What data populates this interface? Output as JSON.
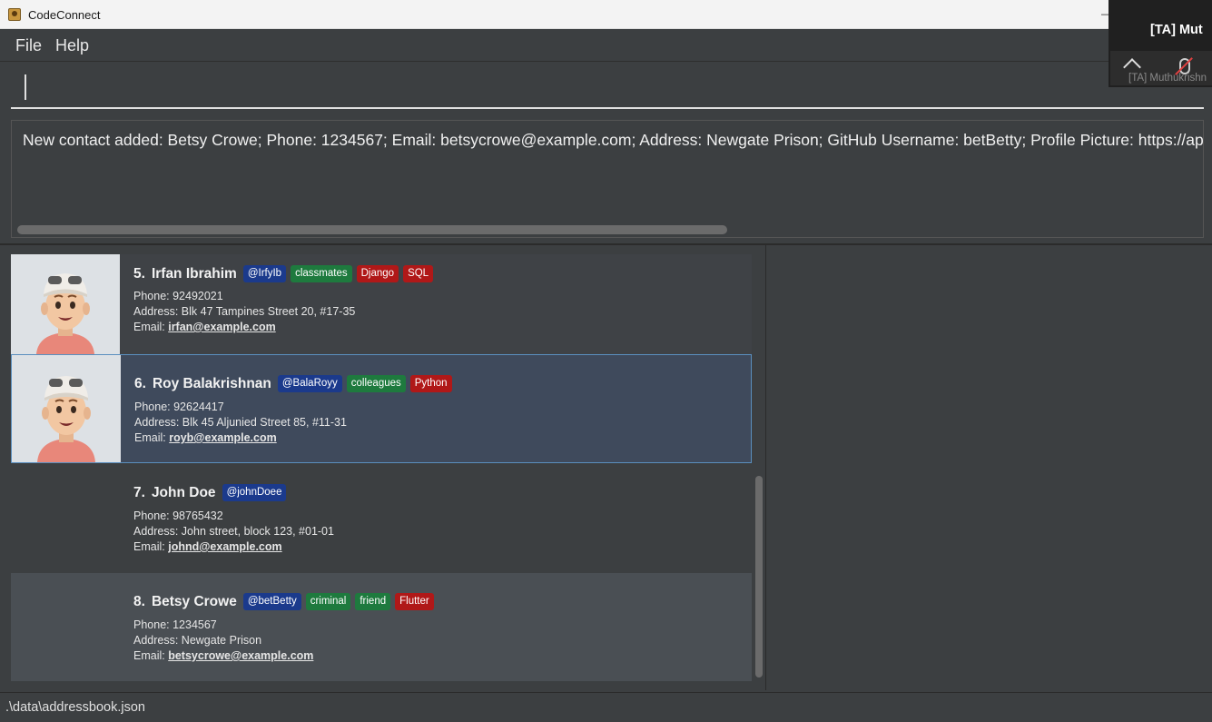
{
  "window": {
    "title": "CodeConnect",
    "minimize_glyph": "—"
  },
  "menu": {
    "file": "File",
    "help": "Help"
  },
  "command": {
    "value": ""
  },
  "result": {
    "text": "New contact added: Betsy Crowe; Phone: 1234567; Email: betsycrowe@example.com; Address: Newgate Prison; GitHub Username: betBetty; Profile Picture: https://api-"
  },
  "contacts": [
    {
      "index": "5.",
      "name": "Irfan Ibrahim",
      "github": "@IrfyIb",
      "tags": [
        "classmates"
      ],
      "skills": [
        "Django",
        "SQL"
      ],
      "phone": "Phone: 92492021",
      "address": "Address: Blk 47 Tampines Street 20, #17-35",
      "email_label": "Email:",
      "email": "irfan@example.com"
    },
    {
      "index": "6.",
      "name": "Roy Balakrishnan",
      "github": "@BalaRoyy",
      "tags": [
        "colleagues"
      ],
      "skills": [
        "Python"
      ],
      "phone": "Phone: 92624417",
      "address": "Address: Blk 45 Aljunied Street 85, #11-31",
      "email_label": "Email:",
      "email": "royb@example.com"
    },
    {
      "index": "7.",
      "name": "John Doe",
      "github": "@johnDoee",
      "tags": [],
      "skills": [],
      "phone": "Phone: 98765432",
      "address": "Address: John street, block 123, #01-01",
      "email_label": "Email:",
      "email": "johnd@example.com"
    },
    {
      "index": "8.",
      "name": "Betsy Crowe",
      "github": "@betBetty",
      "tags": [
        "criminal",
        "friend"
      ],
      "skills": [
        "Flutter"
      ],
      "phone": "Phone: 1234567",
      "address": "Address: Newgate Prison",
      "email_label": "Email:",
      "email": "betsycrowe@example.com"
    }
  ],
  "status": {
    "path": ".\\data\\addressbook.json"
  },
  "meeting_overlay": {
    "name": "[TA]  Mut",
    "sub": "[TA] Muthukrishn"
  },
  "colors": {
    "background": "#3c3f41",
    "github_tag": "#1b3a8c",
    "role_tag": "#1e7a3e",
    "skill_tag": "#b01818",
    "selected_card": "#3f4a5c"
  }
}
